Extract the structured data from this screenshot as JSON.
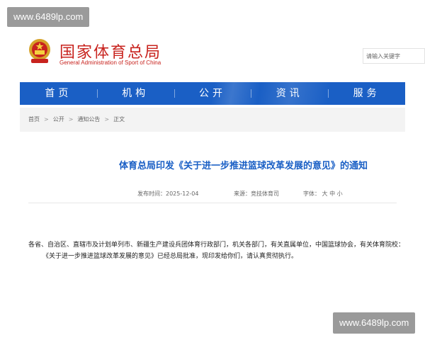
{
  "watermark": {
    "text": "www.6489lp.com"
  },
  "header": {
    "org_name_cn": "国家体育总局",
    "org_name_en": "General Administration of Sport of China",
    "search_placeholder": "请输入关键字",
    "emblem_icon": "national-emblem-icon"
  },
  "nav": {
    "items": [
      {
        "label": "首页"
      },
      {
        "label": "机构"
      },
      {
        "label": "公开"
      },
      {
        "label": "资讯"
      },
      {
        "label": "服务"
      }
    ],
    "color": "#1a5fc5"
  },
  "breadcrumb": {
    "items": [
      "首页",
      "公开",
      "通知公告",
      "正文"
    ],
    "separator": ">"
  },
  "article": {
    "title": "体育总局印发《关于进一步推进篮球改革发展的意见》的通知",
    "publish_label": "发布时间：2025-12-04",
    "source_label": "来源：竞技体育司",
    "font_label": "字体：",
    "font_sizes": [
      "大",
      "中",
      "小"
    ],
    "paragraph_1": "各省、自治区、直辖市及计划单列市、新疆生产建设兵团体育行政部门，机关各部门，有关直属单位，中国篮球协会，有关体育院校：",
    "paragraph_2": "《关于进一步推进篮球改革发展的意见》已经总局批准，现印发给你们，请认真贯彻执行。"
  },
  "colors": {
    "brand_red": "#c8231e",
    "title_blue": "#1a5fc5"
  }
}
